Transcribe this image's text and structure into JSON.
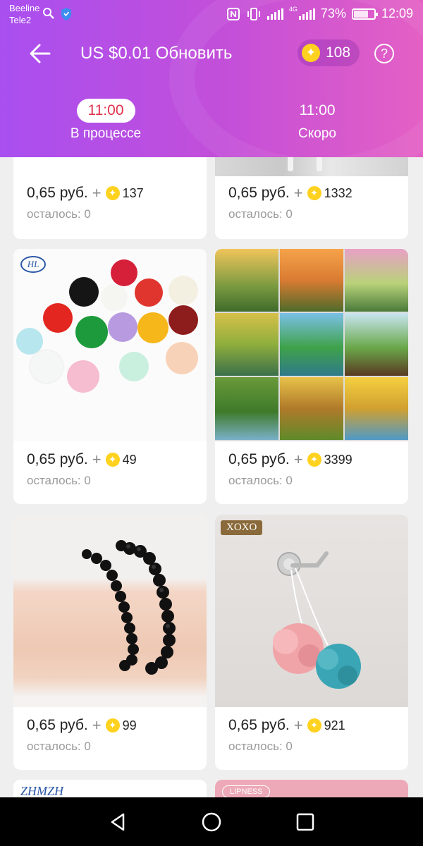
{
  "status_bar": {
    "carrier1": "Beeline",
    "carrier2": "Tele2",
    "network": "4G",
    "battery": "73%",
    "battery_level": 0.73,
    "time": "12:09"
  },
  "header": {
    "title": "US $0.01 Обновить",
    "coins": "108",
    "help": "?"
  },
  "tabs": [
    {
      "time": "11:00",
      "label": "В процессе",
      "active": true
    },
    {
      "time": "11:00",
      "label": "Скоро",
      "active": false
    }
  ],
  "products": [
    {
      "price": "0,65 руб.",
      "plus": "+",
      "coins": "137",
      "remaining": "осталось: 0",
      "brand": ""
    },
    {
      "price": "0,65 руб.",
      "plus": "+",
      "coins": "1332",
      "remaining": "осталось: 0",
      "brand": ""
    },
    {
      "price": "0,65 руб.",
      "plus": "+",
      "coins": "49",
      "remaining": "осталось: 0",
      "brand": "HL"
    },
    {
      "price": "0,65 руб.",
      "plus": "+",
      "coins": "3399",
      "remaining": "осталось: 0",
      "brand": ""
    },
    {
      "price": "0,65 руб.",
      "plus": "+",
      "coins": "99",
      "remaining": "осталось: 0",
      "brand": ""
    },
    {
      "price": "0,65 руб.",
      "plus": "+",
      "coins": "921",
      "remaining": "осталось: 0",
      "brand": "XOXO"
    },
    {
      "brand": "ZHMZH"
    },
    {
      "brand": "LIPNESS"
    }
  ],
  "colors": {
    "header_start": "#a94ff0",
    "header_end": "#e460c4",
    "active_tab_text": "#e0324b",
    "coin": "#ffd21f",
    "page_bg": "#efefef"
  },
  "icons": [
    "back-arrow-icon",
    "search-icon",
    "shield-icon",
    "nfc-icon",
    "vibrate-icon",
    "coin-icon",
    "help-icon",
    "nav-back-icon",
    "nav-home-icon",
    "nav-recents-icon"
  ]
}
